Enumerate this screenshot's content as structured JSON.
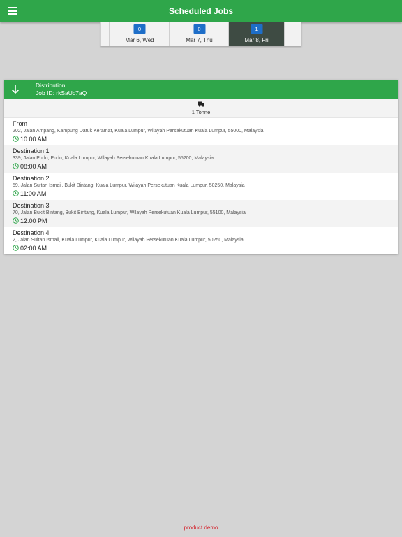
{
  "header": {
    "title": "Scheduled Jobs",
    "menu_icon": "hamburger-menu-icon"
  },
  "dates": [
    {
      "count": "0",
      "label": "Mar 6, Wed",
      "selected": false
    },
    {
      "count": "0",
      "label": "Mar 7, Thu",
      "selected": false
    },
    {
      "count": "1",
      "label": "Mar 8, Fri",
      "selected": true
    }
  ],
  "job": {
    "type": "Distribution",
    "id_text": "Job ID: rkSaUc7aQ",
    "vehicle": "1 Tonne",
    "stops": [
      {
        "name": "From",
        "address": "202, Jalan Ampang, Kampung Datuk Keramat, Kuala Lumpur, Wilayah Persekutuan Kuala Lumpur, 55000, Malaysia",
        "time": "10:00 AM"
      },
      {
        "name": "Destination 1",
        "address": "339, Jalan Pudu, Pudu, Kuala Lumpur, Wilayah Persekutuan Kuala Lumpur, 55200, Malaysia",
        "time": "08:00 AM"
      },
      {
        "name": "Destination 2",
        "address": "59, Jalan Sultan Ismail, Bukit Bintang, Kuala Lumpur, Wilayah Persekutuan Kuala Lumpur, 50250, Malaysia",
        "time": "11:00 AM"
      },
      {
        "name": "Destination 3",
        "address": "70, Jalan Bukit Bintang, Bukit Bintang, Kuala Lumpur, Wilayah Persekutuan Kuala Lumpur, 55100, Malaysia",
        "time": "12:00 PM"
      },
      {
        "name": "Destination 4",
        "address": "2, Jalan Sultan Ismail, Kuala Lumpur, Kuala Lumpur, Wilayah Persekutuan Kuala Lumpur, 50250, Malaysia",
        "time": "02:00 AM"
      }
    ]
  },
  "footer": {
    "brand": "product.demo"
  },
  "colors": {
    "primary": "#2fa64a",
    "badge": "#1e6ec8",
    "selected_tab": "#3e4b43",
    "brand_red": "#d4202a",
    "background": "#d4d4d4"
  }
}
